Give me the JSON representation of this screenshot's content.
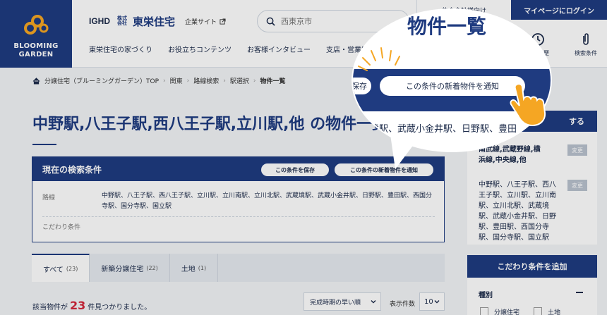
{
  "brand": {
    "line1": "BLOOMING",
    "line2": "GARDEN",
    "color": "#1f3b80",
    "accent": "#f5a623"
  },
  "header": {
    "logo_ighd": "IGHD",
    "logo_tokyo": "東栄住宅",
    "logo_tokyo_prefix": "株式会社",
    "corp_site": "企業サイト",
    "search_placeholder": "西東京市",
    "agency_button": "仲介会社様向け",
    "mypage_button": "マイページにログイン",
    "nav": [
      "東栄住宅の家づくり",
      "お役立ちコンテンツ",
      "お客様インタビュー",
      "支店・営業所"
    ],
    "icons": [
      {
        "label": "閲覧履歴",
        "icon": "clock-icon"
      },
      {
        "label": "検索条件",
        "icon": "paperclip-icon"
      }
    ]
  },
  "breadcrumb": [
    "分譲住宅（ブルーミングガーデン）TOP",
    "関東",
    "路線検索",
    "駅選択",
    "物件一覧"
  ],
  "page_title": "中野駅,八王子駅,西八王子駅,立川駅,他 の物件一覧",
  "condition": {
    "title": "現在の検索条件",
    "save_button": "この条件を保存",
    "notify_button": "この条件の新着物件を通知",
    "route_label": "路線",
    "route_value": "中野駅、八王子駅、西八王子駅、立川駅、立川南駅、立川北駅、武蔵境駅、武蔵小金井駅、日野駅、豊田駅、西国分寺駅、国分寺駅、国立駅",
    "kodawari_label": "こだわり条件"
  },
  "tabs": [
    {
      "label": "すべて",
      "count": "(23)"
    },
    {
      "label": "新築分譲住宅",
      "count": "(22)"
    },
    {
      "label": "土地",
      "count": "(1)"
    }
  ],
  "results": {
    "prefix": "該当物件が",
    "count": "23",
    "suffix": "件見つかりました。",
    "sort_value": "完成時期の早い順",
    "per_page_label": "表示件数",
    "per_page_value": "10"
  },
  "sidebar": {
    "head": "する",
    "line_text_1": "南武線,武蔵野線,横",
    "line_text_2": "浜線,中央線,他",
    "change_label": "変更",
    "station_lines": [
      "中野駅、八王子駅、西八",
      "王子駅、立川駅、立川南",
      "駅、立川北駅、武蔵境",
      "駅、武蔵小金井駅、日野",
      "駅、豊田駅、西国分寺",
      "駅、国分寺駅、国立駅"
    ],
    "kodawari_head": "こだわり条件を追加",
    "kind_label": "種別",
    "kind_options": [
      "分譲住宅",
      "土地"
    ]
  },
  "callout": {
    "title": "物件一覧",
    "pill_a": "保存",
    "pill_b": "この条件の新着物件を通知",
    "stations": "境駅、武蔵小金井駅、日野駅、豊田"
  }
}
